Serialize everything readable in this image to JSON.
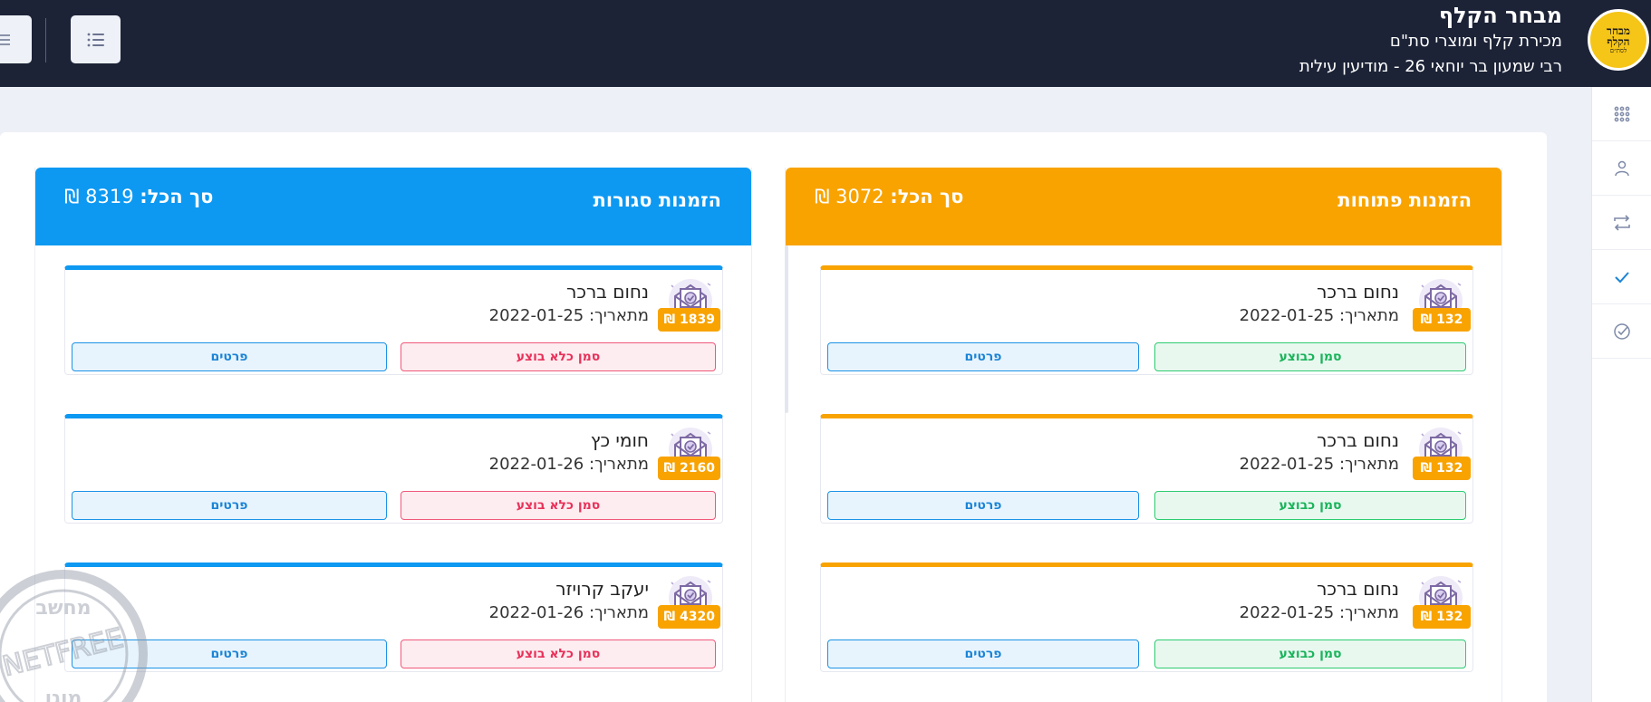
{
  "header": {
    "logo_text_line1": "מבחר",
    "logo_text_line2": "הקלף",
    "logo_text_sub": "לסת״ם",
    "title": "מבחר הקלף",
    "subtitle": "מכירת קלף ומוצרי סת\"ם",
    "address": "רבי שמעון בר יוחאי 26 - מודיעין עילית"
  },
  "sidebar": {
    "items": [
      {
        "icon": "apps-grid-icon"
      },
      {
        "icon": "user-icon"
      },
      {
        "icon": "transfer-icon"
      },
      {
        "icon": "check-icon"
      },
      {
        "icon": "check-circle-icon"
      }
    ]
  },
  "open_orders": {
    "title": "הזמנות פתוחות",
    "total_label": "סך הכל:",
    "total_value": "3072 ₪",
    "color": "#f8a300",
    "orders": [
      {
        "name": "נחום ברכר",
        "date": "מתאריך: 2022-01-25",
        "price": "132 ₪",
        "action": "סמן כבוצע",
        "details": "פרטים"
      },
      {
        "name": "נחום ברכר",
        "date": "מתאריך: 2022-01-25",
        "price": "132 ₪",
        "action": "סמן כבוצע",
        "details": "פרטים"
      },
      {
        "name": "נחום ברכר",
        "date": "מתאריך: 2022-01-25",
        "price": "132 ₪",
        "action": "סמן כבוצע",
        "details": "פרטים"
      }
    ]
  },
  "closed_orders": {
    "title": "הזמנות סגורות",
    "total_label": "סך הכל:",
    "total_value": "8319 ₪",
    "color": "#0d99f2",
    "orders": [
      {
        "name": "נחום ברכר",
        "date": "מתאריך: 2022-01-25",
        "price": "1839 ₪",
        "action": "סמן כלא בוצע",
        "details": "פרטים"
      },
      {
        "name": "חומי כץ",
        "date": "מתאריך: 2022-01-26",
        "price": "2160 ₪",
        "action": "סמן כלא בוצע",
        "details": "פרטים"
      },
      {
        "name": "יעקב קרויזר",
        "date": "מתאריך: 2022-01-26",
        "price": "4320 ₪",
        "action": "סמן כלא בוצע",
        "details": "פרטים"
      }
    ]
  },
  "watermark": {
    "text_top": "מחשב",
    "text_mid": "NETFREE",
    "text_bottom": "מוגן"
  }
}
